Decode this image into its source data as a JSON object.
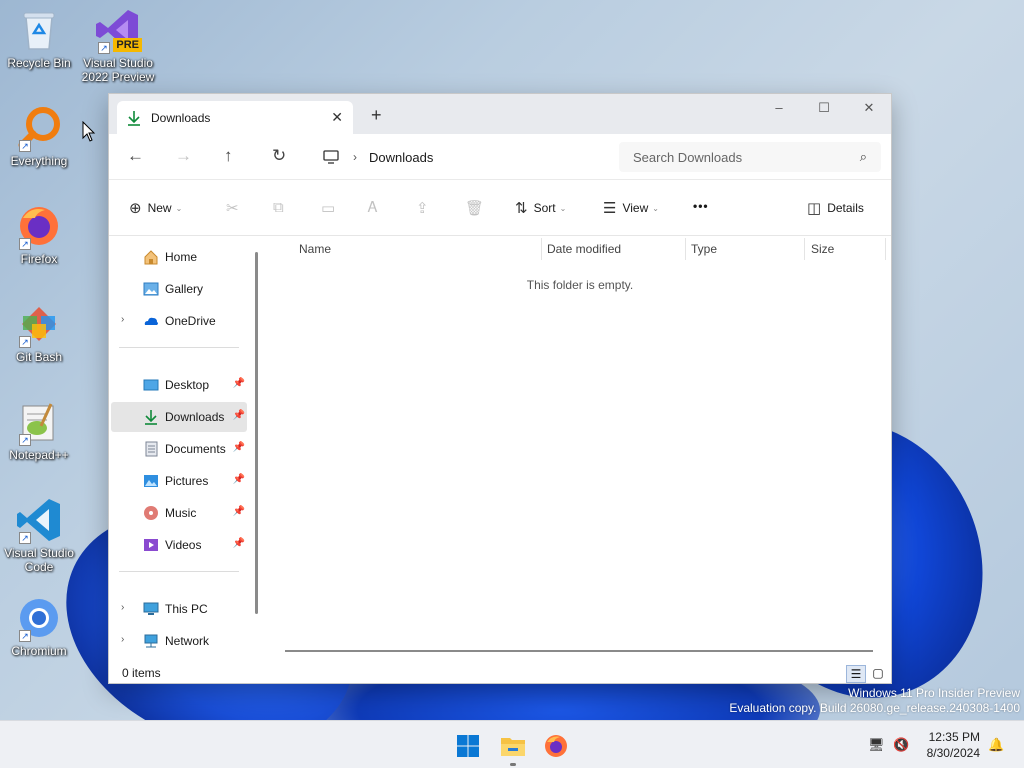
{
  "desktop": {
    "icons": [
      {
        "label": "Recycle Bin",
        "icon": "recycle-bin-icon"
      },
      {
        "label": "Visual Studio 2022 Preview",
        "icon": "visual-studio-icon",
        "badge": "PRE"
      },
      {
        "label": "Everything",
        "icon": "everything-search-icon"
      },
      {
        "label": "Firefox",
        "icon": "firefox-icon"
      },
      {
        "label": "Git Bash",
        "icon": "git-bash-icon"
      },
      {
        "label": "Notepad++",
        "icon": "notepad-plus-plus-icon"
      },
      {
        "label": "Visual Studio Code",
        "icon": "vscode-icon"
      },
      {
        "label": "Chromium",
        "icon": "chromium-icon"
      }
    ]
  },
  "explorer": {
    "tab": {
      "label": "Downloads",
      "icon": "download-icon"
    },
    "window_controls": {
      "minimize": "–",
      "maximize": "☐",
      "close": "✕"
    },
    "address": {
      "root_icon": "computer-icon",
      "crumb": "Downloads"
    },
    "search": {
      "placeholder": "Search Downloads"
    },
    "commands": {
      "new": "New",
      "sort": "Sort",
      "view": "View",
      "more": "•••",
      "details": "Details"
    },
    "nav_pane": {
      "quick": [
        {
          "label": "Home",
          "icon": "home-icon"
        },
        {
          "label": "Gallery",
          "icon": "gallery-icon"
        },
        {
          "label": "OneDrive",
          "icon": "onedrive-icon",
          "expandable": true
        }
      ],
      "pinned": [
        {
          "label": "Desktop",
          "icon": "desktop-folder-icon"
        },
        {
          "label": "Downloads",
          "icon": "download-icon",
          "selected": true
        },
        {
          "label": "Documents",
          "icon": "documents-icon"
        },
        {
          "label": "Pictures",
          "icon": "pictures-icon"
        },
        {
          "label": "Music",
          "icon": "music-icon"
        },
        {
          "label": "Videos",
          "icon": "videos-icon"
        }
      ],
      "locations": [
        {
          "label": "This PC",
          "icon": "this-pc-icon"
        },
        {
          "label": "Network",
          "icon": "network-icon"
        }
      ]
    },
    "columns": [
      "Name",
      "Date modified",
      "Type",
      "Size"
    ],
    "empty_message": "This folder is empty.",
    "status": {
      "item_count": "0 items"
    }
  },
  "watermark": {
    "line1": "Windows 11 Pro Insider Preview",
    "line2": "Evaluation copy. Build 26080.ge_release.240308-1400"
  },
  "taskbar": {
    "time": "12:35 PM",
    "date": "8/30/2024"
  },
  "colors": {
    "accent": "#0f6cbd",
    "download_green": "#0f8a3a",
    "selected_bg": "#e5e5e5"
  }
}
